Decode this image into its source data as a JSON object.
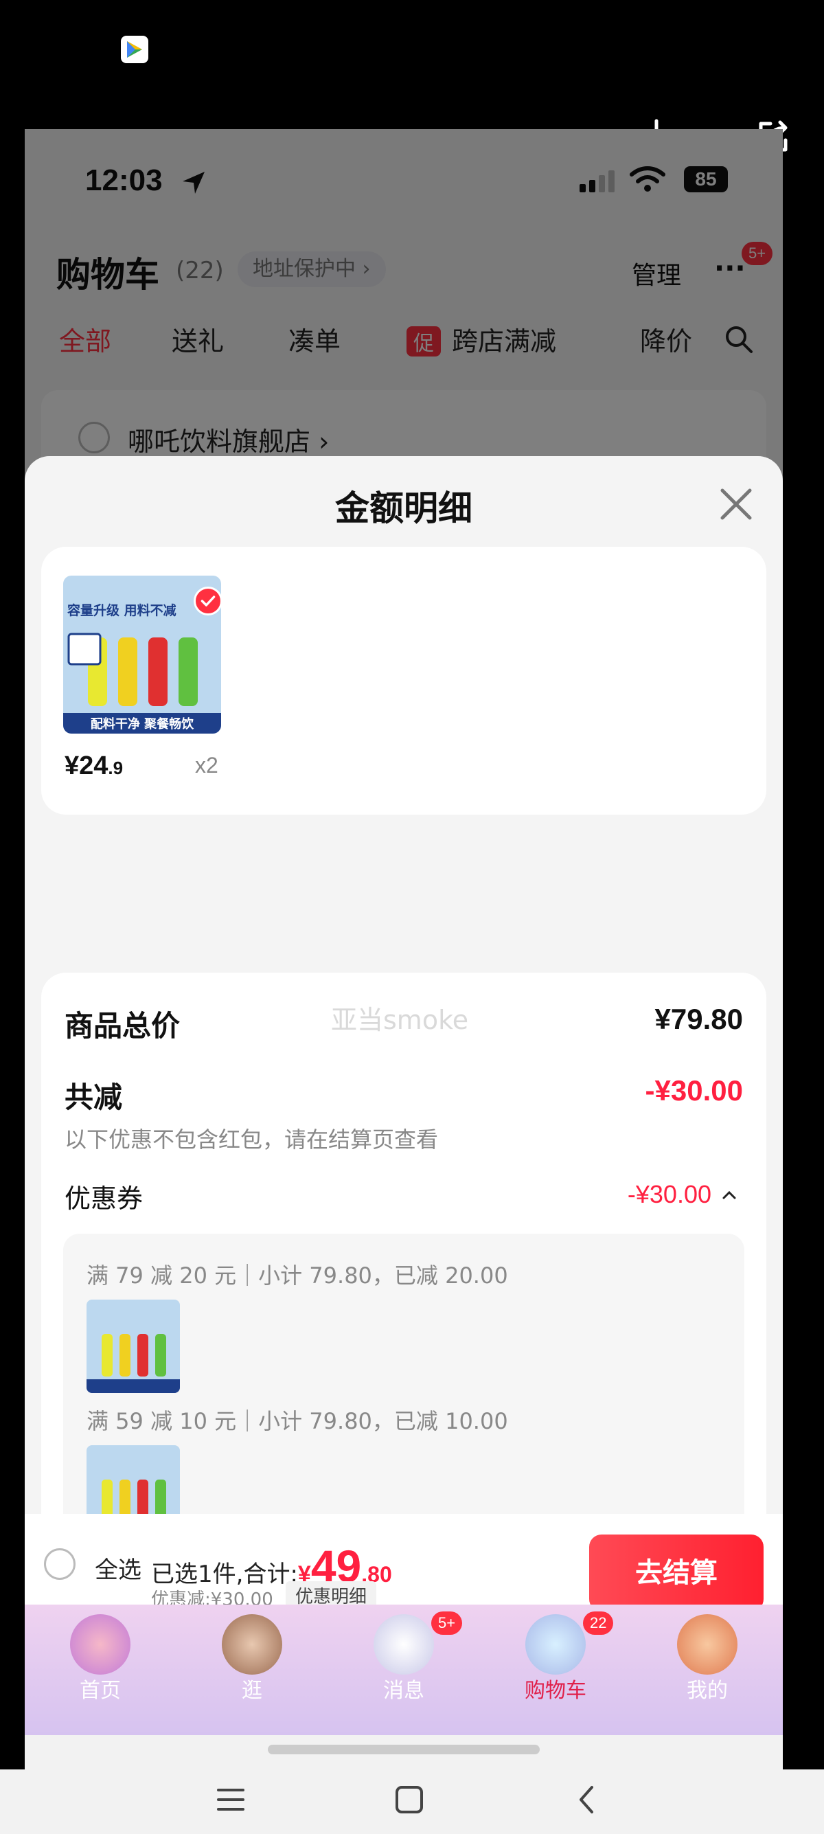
{
  "status": {
    "time": "12:03",
    "battery": "85"
  },
  "cart": {
    "title": "购物车",
    "count": "(22)",
    "address": "地址保护中 ›",
    "manage": "管理",
    "more_badge": "5+",
    "tabs": [
      "全部",
      "送礼",
      "凑单",
      "跨店满减",
      "降价"
    ],
    "promo_tag": "促",
    "store_name": "哪吒饮料旗舰店 ›"
  },
  "sheet": {
    "title": "金额明细",
    "product": {
      "image_banner": "容量升级 用料不减",
      "image_footer": "配料干净 聚餐畅饮",
      "price_int": "¥24",
      "price_dec": ".9",
      "qty": "x2"
    },
    "summary": {
      "watermark": "亚当smoke",
      "total_label": "商品总价",
      "total_value": "¥79.80",
      "reduce_label": "共减",
      "reduce_value": "-¥30.00",
      "note": "以下优惠不包含红包，请在结算页查看",
      "coupon_label": "优惠券",
      "coupon_value": "-¥30.00",
      "rules": [
        "满 79 减 20 元｜小计 79.80，已减 20.00",
        "满 59 减 10 元｜小计 79.80，已减 10.00"
      ]
    }
  },
  "bottom": {
    "select_all": "全选",
    "selected_text": "已选1件,合计:",
    "total_yen": "¥",
    "total_int": "49",
    "total_dec": ".80",
    "discount": "优惠减:¥30.00",
    "detail": "优惠明细",
    "checkout": "去结算"
  },
  "tabbar": [
    {
      "label": "首页"
    },
    {
      "label": "逛"
    },
    {
      "label": "消息",
      "badge": "5+"
    },
    {
      "label": "购物车",
      "badge": "22"
    },
    {
      "label": "我的"
    }
  ],
  "colors": {
    "accent": "#ff2040",
    "active_tab": "#e0204a"
  }
}
